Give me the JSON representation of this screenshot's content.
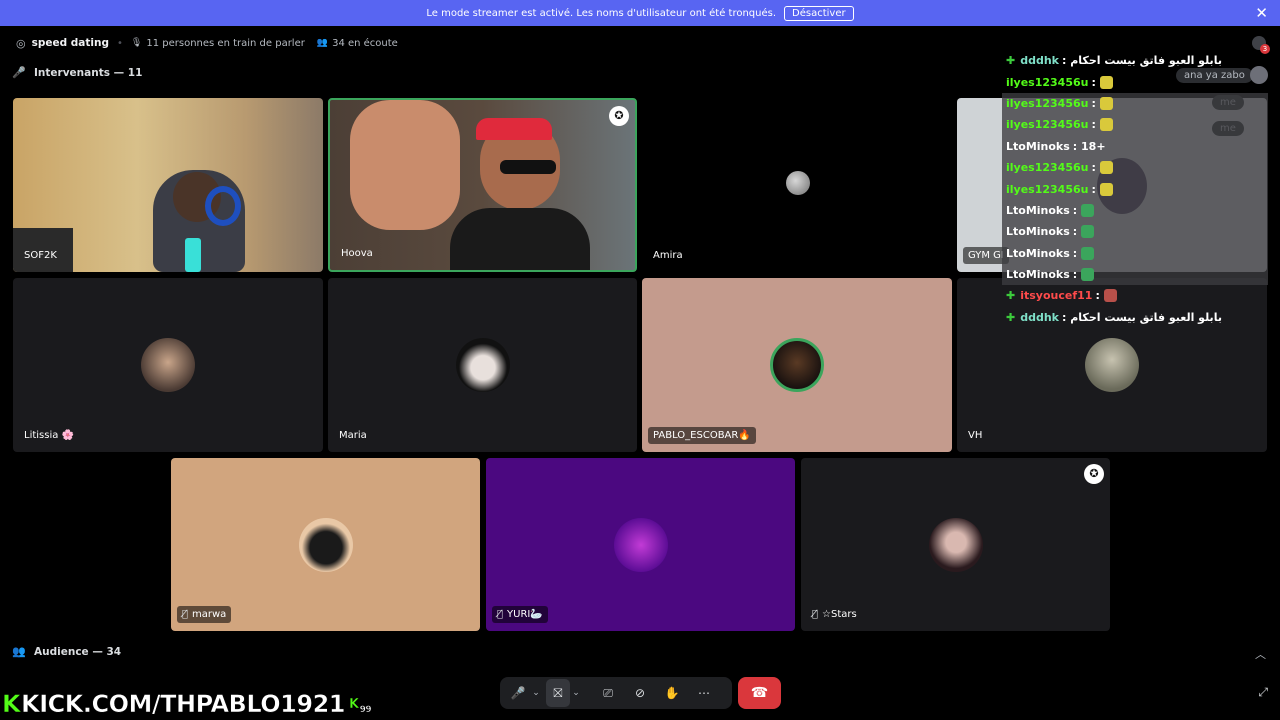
{
  "banner": {
    "text": "Le mode streamer est activé. Les noms d'utilisateur ont été tronqués.",
    "button": "Désactiver",
    "close": "✕"
  },
  "header": {
    "channel": "speed dating",
    "speaking": "11 personnes en train de parler",
    "listening": "34 en écoute",
    "inbox_count": "3"
  },
  "speakers_label": "Intervenants — 11",
  "audience_label": "Audience — 34",
  "tiles": {
    "sof2k": "SOF2K",
    "hoova": "Hoova",
    "amira": "Amira",
    "gym": "GYM GI",
    "litissia": "Litissia 🌸",
    "maria": "Maria",
    "pablo": "PABLO_ESCOBAR🔥",
    "vh": "VH",
    "marwa": "marwa",
    "yuri": "YURI🦢",
    "stars": "☆Stars"
  },
  "chat": [
    {
      "user": "dddhk",
      "text": ": بابلو العبو فاتق بيست احكام",
      "plus": true,
      "bg": false
    },
    {
      "user": "ilyes123456u",
      "text": ":",
      "bg": false
    },
    {
      "user": "ilyes123456u",
      "text": ":",
      "bg": true
    },
    {
      "user": "ilyes123456u",
      "text": ":",
      "bg": true
    },
    {
      "user": "LtoMinoks",
      "text": ": 18+",
      "bg": true
    },
    {
      "user": "ilyes123456u",
      "text": ":",
      "bg": true
    },
    {
      "user": "ilyes123456u",
      "text": ":",
      "bg": true
    },
    {
      "user": "LtoMinoks",
      "text": ":",
      "bg": true
    },
    {
      "user": "LtoMinoks",
      "text": ":",
      "bg": true
    },
    {
      "user": "LtoMinoks",
      "text": ":",
      "bg": true
    },
    {
      "user": "LtoMinoks",
      "text": ":",
      "bg": true
    },
    {
      "user": "itsyoucef11",
      "text": ":",
      "plus": true,
      "bg": false
    },
    {
      "user": "dddhk",
      "text": ": بابلو العبو فاتق بيست احكام",
      "plus": true,
      "bg": false
    }
  ],
  "side_msgs": [
    "ana ya zabo",
    "me",
    "me"
  ],
  "kick": {
    "text": "KICK.COM/THPABLO1921",
    "count": "99"
  },
  "colors": {
    "banner": "#5865f2",
    "hangup": "#da373c",
    "kick_green": "#53fc18"
  }
}
